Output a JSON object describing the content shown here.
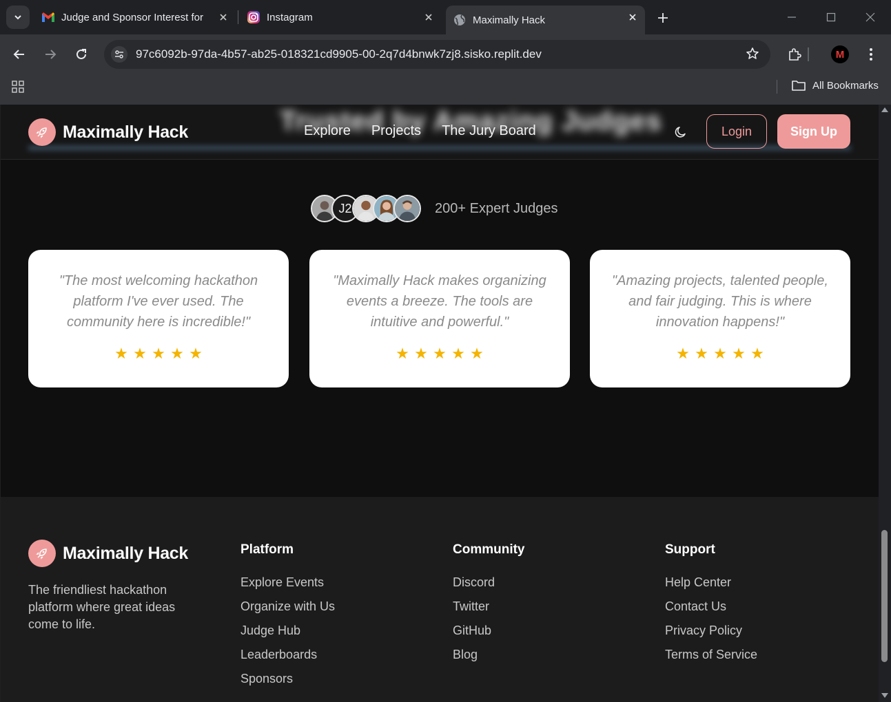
{
  "browser": {
    "tabs": [
      {
        "title": "Judge and Sponsor Interest for",
        "icon": "gmail-icon",
        "active": false
      },
      {
        "title": "Instagram",
        "icon": "instagram-icon",
        "active": false
      },
      {
        "title": "Maximally Hack",
        "icon": "globe-icon",
        "active": true
      }
    ],
    "url": "97c6092b-97da-4b57-ab25-018321cd9905-00-2q7d4bnwk7zj8.sisko.replit.dev",
    "bookmarks_label": "All Bookmarks",
    "profile_initial": "M"
  },
  "site": {
    "brand": "Maximally Hack",
    "blurred_heading": "Trusted by Amazing Judges",
    "nav": [
      "Explore",
      "Projects",
      "The Jury Board"
    ],
    "login_label": "Login",
    "signup_label": "Sign Up",
    "judges": {
      "initials_avatar": "J2",
      "text": "200+ Expert Judges"
    },
    "testimonials": [
      {
        "quote": "\"The most welcoming hackathon platform I've ever used. The community here is incredible!\"",
        "rating": 5
      },
      {
        "quote": "\"Maximally Hack makes organizing events a breeze. The tools are intuitive and powerful.\"",
        "rating": 5
      },
      {
        "quote": "\"Amazing projects, talented people, and fair judging. This is where innovation happens!\"",
        "rating": 5
      }
    ]
  },
  "footer": {
    "brand": "Maximally Hack",
    "description": "The friendliest hackathon platform where great ideas come to life.",
    "columns": [
      {
        "heading": "Platform",
        "links": [
          "Explore Events",
          "Organize with Us",
          "Judge Hub",
          "Leaderboards",
          "Sponsors"
        ]
      },
      {
        "heading": "Community",
        "links": [
          "Discord",
          "Twitter",
          "GitHub",
          "Blog"
        ]
      },
      {
        "heading": "Support",
        "links": [
          "Help Center",
          "Contact Us",
          "Privacy Policy",
          "Terms of Service"
        ]
      }
    ]
  },
  "colors": {
    "accent": "#ef9a9a",
    "star": "#f4b400",
    "page_bg": "#0f0f10",
    "footer_bg": "#1c1c1d"
  }
}
